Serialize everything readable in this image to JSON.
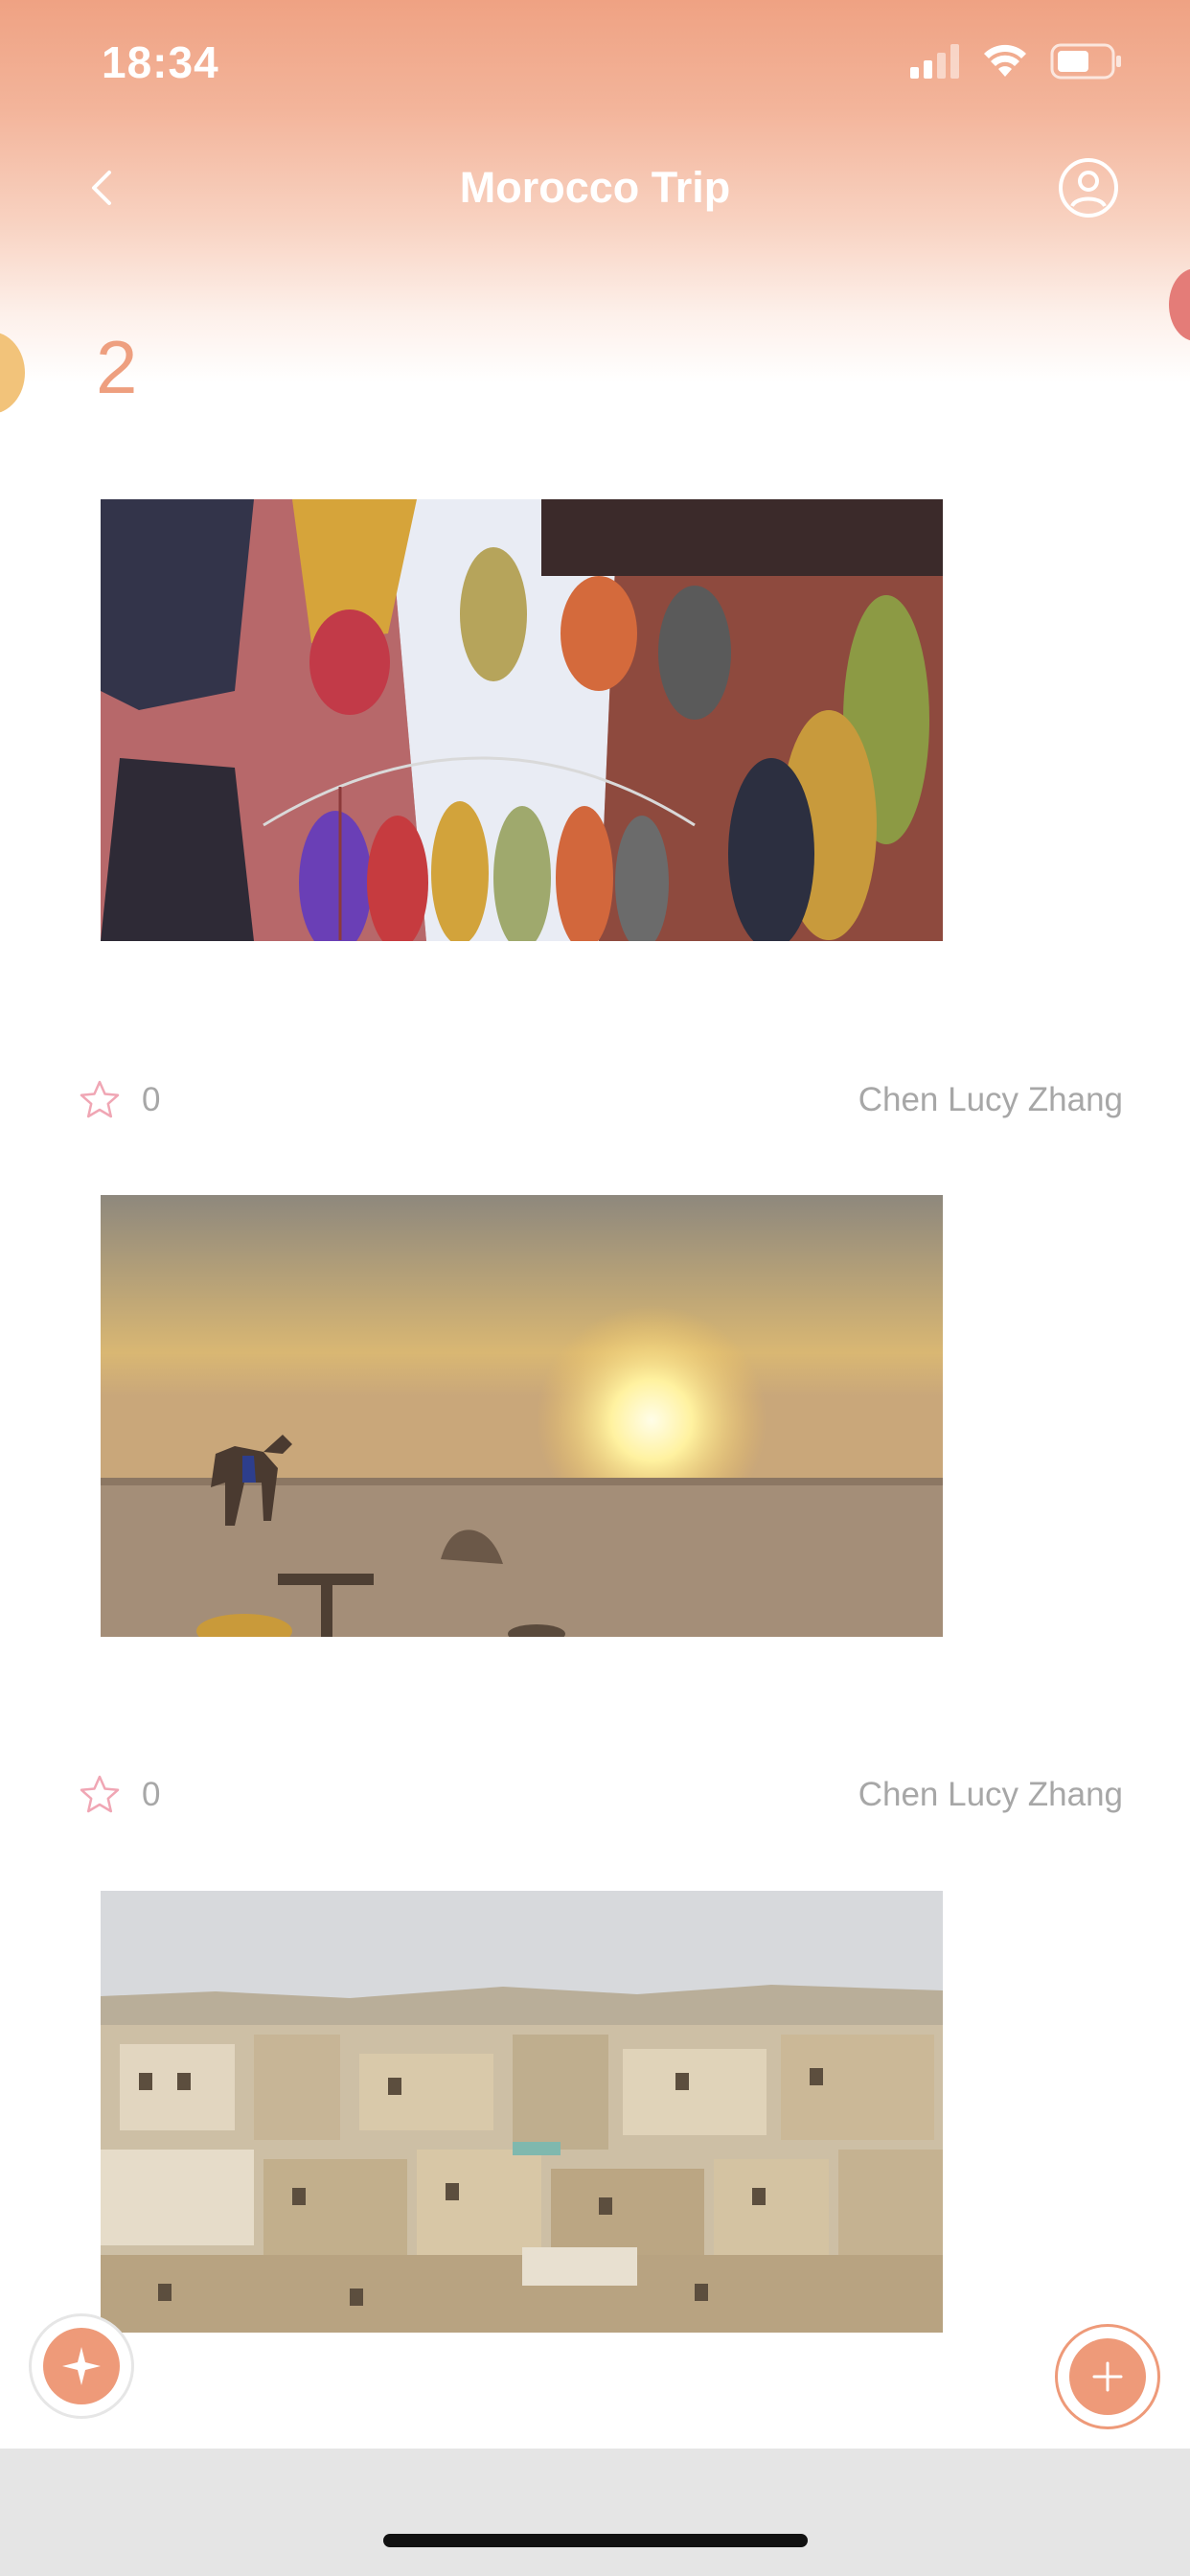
{
  "status_bar": {
    "time": "18:34",
    "icons": [
      "signal-icon",
      "wifi-icon",
      "battery-icon"
    ]
  },
  "nav": {
    "title": "Morocco Trip",
    "back_icon": "chevron-left-icon",
    "profile_icon": "user-circle-icon"
  },
  "album": {
    "photo_count": "2"
  },
  "posts": [
    {
      "image": "yarn-market-photo",
      "likes": "0",
      "author": "Chen Lucy Zhang"
    },
    {
      "image": "desert-sunset-camels-photo",
      "likes": "0",
      "author": "Chen Lucy Zhang"
    },
    {
      "image": "medina-rooftops-photo"
    }
  ],
  "fab": {
    "left_icon": "compass-star-icon",
    "right_icon": "plus-icon"
  },
  "colors": {
    "accent": "#EE9A79",
    "header_top": "#EFA283",
    "muted_text": "#A7A7A7"
  }
}
